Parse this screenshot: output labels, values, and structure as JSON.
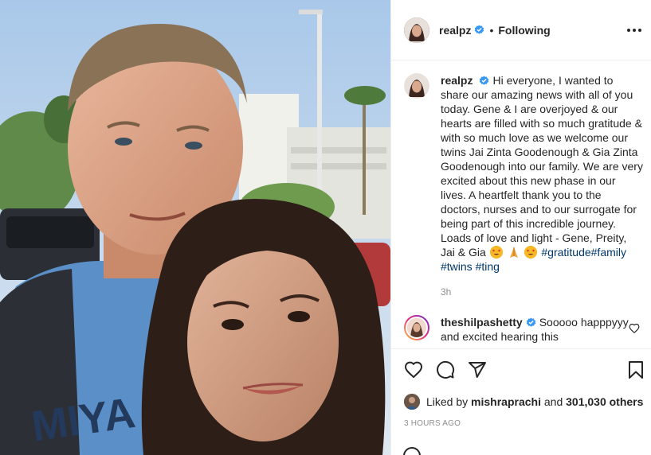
{
  "post": {
    "username": "realpz",
    "follow_state": "Following",
    "dot": "•",
    "caption": {
      "username": "realpz",
      "text_1": "Hi everyone, I wanted to share our amazing news with all of you today. Gene & I are overjoyed & our hearts are filled with so much gratitude & with so much love as we welcome our twins Jai Zinta Goodenough & Gia Zinta Goodenough into our family. We are very excited about this new phase in our lives. A heartfelt thank you to the doctors, nurses and to our surrogate for being part of this incredible journey. Loads of love and light - Gene, Preity, Jai & Gia",
      "hashtags_1": "#gratitude#family",
      "hashtag_twins": "#twins",
      "hashtag_ting": "#ting",
      "time": "3h"
    },
    "comment": {
      "username": "theshilpashetty",
      "text": "Sooooo happpyyy and excited hearing this"
    },
    "likes": {
      "prefix": "Liked by",
      "user": "mishraprachi",
      "and": "and",
      "others": "301,030 others"
    },
    "timestamp": "3 HOURS AGO"
  },
  "icons": {
    "header_avatar": "avatar",
    "verified": "verified-badge-icon",
    "more": "more-options-icon",
    "like": "heart-icon",
    "comment": "comment-bubble-icon",
    "share": "paper-plane-icon",
    "save": "bookmark-icon",
    "comment_like": "heart-icon"
  },
  "colors": {
    "verified_blue": "#3897f0",
    "hashtag": "#00376b",
    "muted": "#8e8e8e"
  }
}
